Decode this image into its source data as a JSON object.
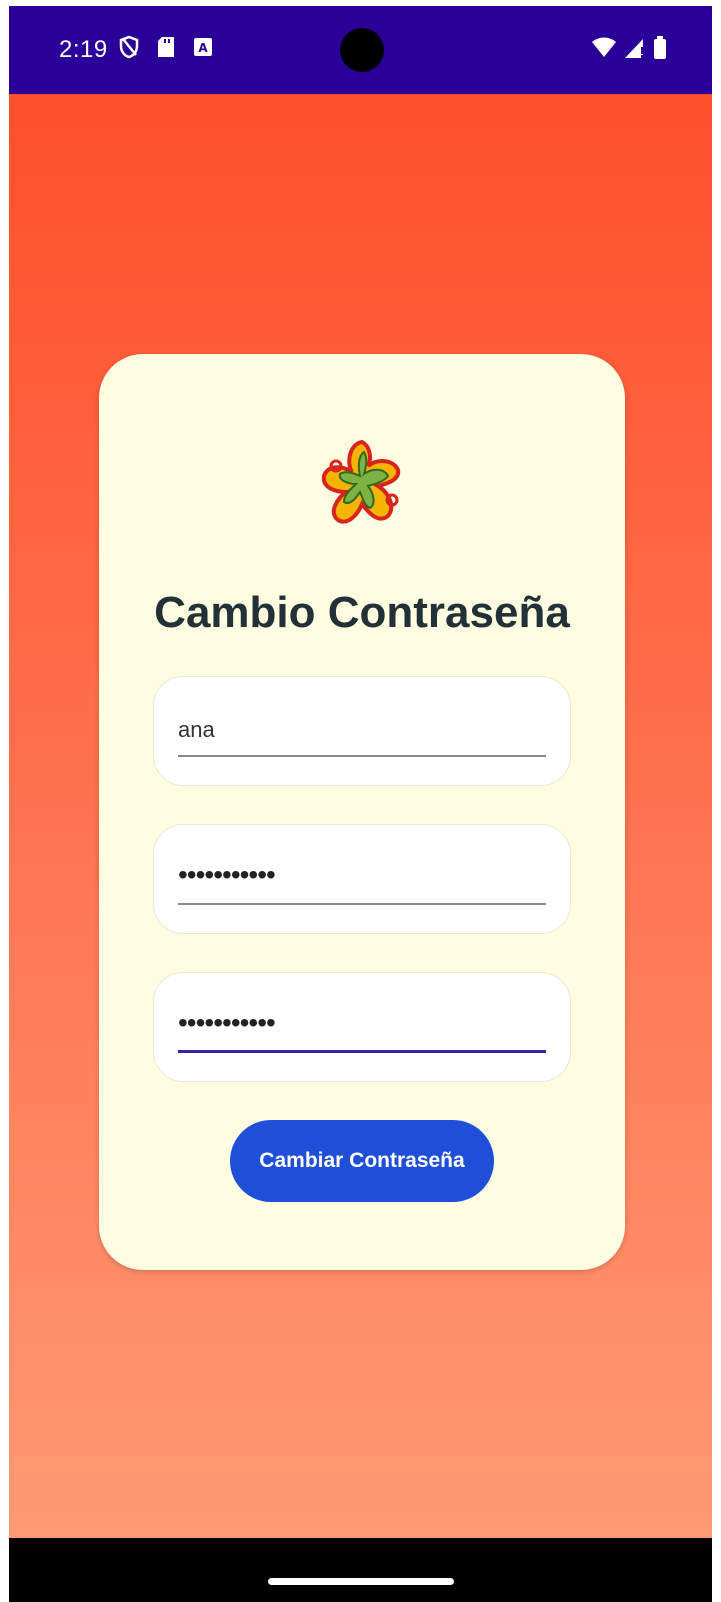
{
  "status_bar": {
    "time": "2:19",
    "icons_left": [
      "shield-icon",
      "sd-card-icon",
      "keyboard-a-icon"
    ],
    "icons_right": [
      "wifi-icon",
      "cell-signal-icon",
      "battery-icon"
    ],
    "background": "#2a0098"
  },
  "screen": {
    "title": "Cambio Contraseña",
    "username_field": {
      "value": "ana"
    },
    "password_field": {
      "masked_value": "•••••••••••"
    },
    "confirm_password_field": {
      "masked_value": "•••••••••••",
      "focused": true
    },
    "submit_button": {
      "label": "Cambiar Contraseña",
      "color": "#1f4fd8"
    }
  },
  "colors": {
    "gradient_top": "#ff4f2c",
    "gradient_bottom": "#ff9a74",
    "card": "#fefde2",
    "title": "#223138",
    "focus_underline": "#3b1fa6"
  },
  "logo": {
    "icon": "star-fruit-logo-icon"
  }
}
